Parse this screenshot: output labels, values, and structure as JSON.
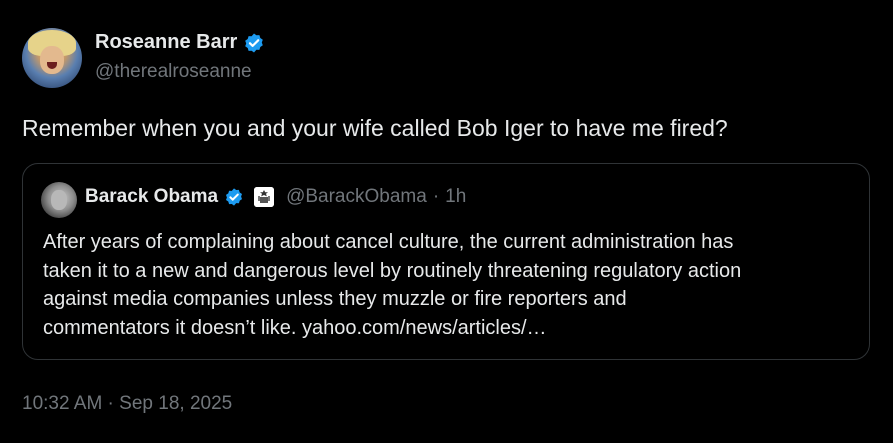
{
  "author": {
    "display_name": "Roseanne Barr",
    "handle": "@therealroseanne",
    "verified_icon": "verified-badge-icon"
  },
  "tweet": {
    "text": "Remember when you and your wife called Bob Iger to have me fired?",
    "timestamp": "10:32 AM · Sep 18, 2025"
  },
  "quoted_tweet": {
    "display_name": "Barack Obama",
    "handle": "@BarackObama",
    "separator": "·",
    "time": "1h",
    "verified_icon": "verified-badge-icon",
    "affiliation_icon": "government-seal-icon",
    "lines": [
      "After years of complaining about cancel culture, the current administration has",
      "taken it to a new and dangerous level by routinely threatening regulatory action",
      "against media companies unless they muzzle or fire reporters and",
      "commentators it doesn’t like. yahoo.com/news/articles/…"
    ]
  },
  "colors": {
    "background": "#000000",
    "primary_text": "#e7e9ea",
    "secondary_text": "#71767b",
    "verified_blue": "#1d9bf0",
    "card_border": "#2f3336"
  }
}
